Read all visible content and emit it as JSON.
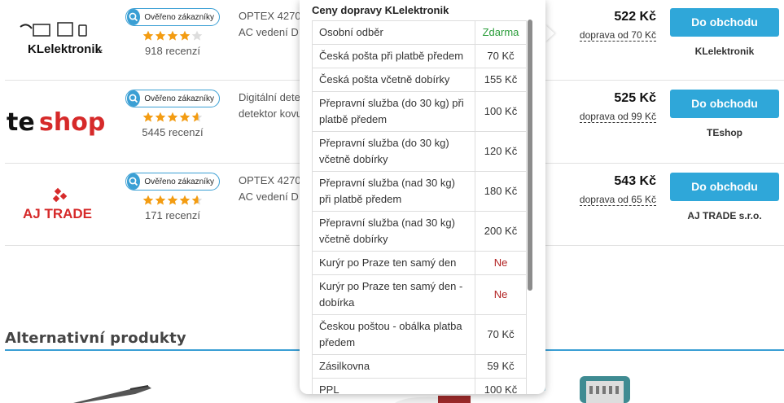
{
  "offers": [
    {
      "shop_logo_text": "KLelektronik",
      "badge": "Ověřeno zákazníky",
      "stars": 4,
      "half_star": false,
      "reviews": "918 recenzí",
      "desc_line1": "OPTEX 4270",
      "desc_line2": "AC vedení D",
      "price": "522 Kč",
      "shipping": "doprava od 70 Kč",
      "button": "Do obchodu",
      "shop_name": "KLelektronik"
    },
    {
      "shop_logo_text": "teshop",
      "badge": "Ověřeno zákazníky",
      "stars": 4,
      "half_star": true,
      "reviews": "5445 recenzí",
      "desc_line1": "Digitální dete",
      "desc_line2": "detektor kovu",
      "price": "525 Kč",
      "shipping": "doprava od 99 Kč",
      "button": "Do obchodu",
      "shop_name": "TEshop"
    },
    {
      "shop_logo_text": "AJ TRADE",
      "badge": "Ověřeno zákazníky",
      "stars": 4,
      "half_star": true,
      "reviews": "171 recenzí",
      "desc_line1": "OPTEX 4270",
      "desc_line2": "AC vedení D",
      "price": "543 Kč",
      "shipping": "doprava od 65 Kč",
      "button": "Do obchodu",
      "shop_name": "AJ TRADE s.r.o."
    }
  ],
  "alternatives": {
    "title": "Alternativní produkty"
  },
  "popup": {
    "title": "Ceny dopravy KLelektronik",
    "rows": [
      {
        "label": "Osobní odběr",
        "value": "Zdarma",
        "kind": "free"
      },
      {
        "label": "Česká pošta při platbě předem",
        "value": "70 Kč",
        "kind": "price"
      },
      {
        "label": "Česká pošta včetně dobírky",
        "value": "155 Kč",
        "kind": "price"
      },
      {
        "label": "Přepravní služba (do 30 kg) při platbě předem",
        "value": "100 Kč",
        "kind": "price"
      },
      {
        "label": "Přepravní služba (do 30 kg) včetně dobírky",
        "value": "120 Kč",
        "kind": "price"
      },
      {
        "label": "Přepravní služba (nad 30 kg) při platbě předem",
        "value": "180 Kč",
        "kind": "price"
      },
      {
        "label": "Přepravní služba (nad 30 kg) včetně dobírky",
        "value": "200 Kč",
        "kind": "price"
      },
      {
        "label": "Kurýr po Praze ten samý den",
        "value": "Ne",
        "kind": "no"
      },
      {
        "label": "Kurýr po Praze ten samý den - dobírka",
        "value": "Ne",
        "kind": "no"
      },
      {
        "label": "Českou poštou - obálka platba předem",
        "value": "70 Kč",
        "kind": "price"
      },
      {
        "label": "Zásilkovna",
        "value": "59 Kč",
        "kind": "price"
      },
      {
        "label": "PPL",
        "value": "100 Kč",
        "kind": "price"
      }
    ]
  },
  "colors": {
    "accent": "#2fa7d9",
    "star": "#f39c12",
    "free": "#2a9d3a",
    "no": "#b22222",
    "ajtrade": "#d62a2a",
    "teshop_red": "#d62a2a"
  },
  "icons": {
    "badge": "verified-check-icon",
    "star": "star-icon"
  }
}
